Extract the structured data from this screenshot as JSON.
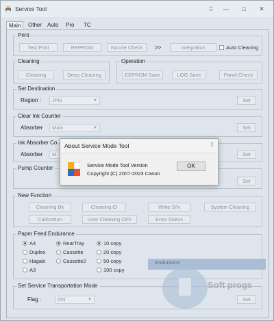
{
  "window": {
    "title": "Service Tool",
    "app_icon": "printer-icon",
    "controls": {
      "minimize": "—",
      "maximize": "□",
      "close": "✕",
      "grip": "⁞⁞"
    }
  },
  "tabs": [
    "Main",
    "Other",
    "Auto",
    "Pro",
    "TC"
  ],
  "print": {
    "label": "Print",
    "buttons": [
      "Test Print",
      "EEPROM",
      "Nozzle Check",
      "Integration"
    ],
    "arrow": ">>",
    "checkbox": "Auto Cleaning"
  },
  "cleaning": {
    "label": "Cleaning",
    "buttons": [
      "Cleaning",
      "Deep Cleaning"
    ]
  },
  "operation": {
    "label": "Operation",
    "buttons": [
      "EEPROM Save",
      "LOG Save",
      "Panel Check"
    ]
  },
  "set_destination": {
    "label": "Set Destination",
    "field_label": "Region :",
    "value": "JPN",
    "set": "Set"
  },
  "clear_ink_counter": {
    "label": "Clear Ink Counter",
    "field_label": "Absorber",
    "value": "Main",
    "set": "Set"
  },
  "ink_absorber": {
    "label": "Ink Absorber Co",
    "field_label": "Absorber",
    "value": "M",
    "set": "Set"
  },
  "pump_counter": {
    "label": "Pump Counter",
    "set": "Set"
  },
  "new_function": {
    "label": "New Function",
    "buttons": [
      "Cleaning Bk",
      "Cleaning Cl",
      "Write S/N",
      "System Cleaning",
      "Calibration",
      "User Cleaning OFF",
      "Error Status"
    ]
  },
  "paper_feed": {
    "label": "Paper Feed Endurance",
    "col1": [
      "A4",
      "Duplex",
      "Hagaki",
      "A3"
    ],
    "col2": [
      "RearTray",
      "Cassette",
      "Cassette2"
    ],
    "col3": [
      "10 copy",
      "20 copy",
      "50 copy",
      "100 copy"
    ],
    "endurance": "Endurance"
  },
  "transport": {
    "label": "Set Service Transportation Mode",
    "field_label": "Flag :",
    "value": "ON",
    "set": "Set"
  },
  "dialog": {
    "title": "About Service Mode Tool",
    "grip": "⁞⁞",
    "line1": "Service Mode Tool  Version",
    "line2": "Copyright (C) 2007-2023 Canon",
    "ok": "OK",
    "icon": "app-logo-icon"
  },
  "watermark": {
    "text": "Soft progs"
  }
}
